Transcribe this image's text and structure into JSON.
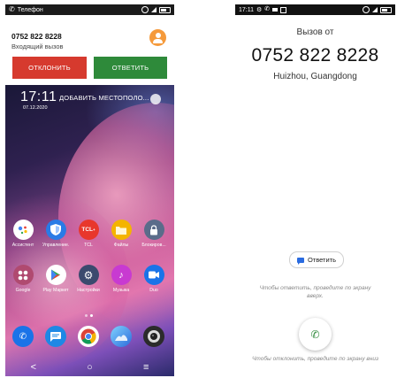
{
  "left_phone": {
    "statusbar": {
      "app_name": "Телефон"
    },
    "incoming_call": {
      "number": "0752 822 8228",
      "subtitle": "Входящий вызов",
      "decline_label": "ОТКЛОНИТЬ",
      "accept_label": "ОТВЕТИТЬ",
      "decline_color": "#d63a2e",
      "accept_color": "#2e8a3a",
      "avatar_color": "#f59a3b"
    },
    "home": {
      "clock": "17:11",
      "date": "07.12.2020",
      "add_location": "ДОБАВИТЬ МЕСТОПОЛО...",
      "apps_row1": [
        {
          "label": "Ассистент",
          "icon": "assistant-icon",
          "color": "#ffffff"
        },
        {
          "label": "Управление...",
          "icon": "shield-icon",
          "color": "#2a7be6"
        },
        {
          "label": "TCL",
          "icon": "tcl-icon",
          "color": "#e8372c"
        },
        {
          "label": "Файлы",
          "icon": "folder-icon",
          "color": "#f4b400"
        },
        {
          "label": "Блокиров...",
          "icon": "lock-icon",
          "color": "#5a6c8a"
        }
      ],
      "apps_row2": [
        {
          "label": "Google",
          "icon": "google-folder-icon",
          "color": "#b04a70"
        },
        {
          "label": "Play Маркет",
          "icon": "play-store-icon",
          "color": "#ffffff"
        },
        {
          "label": "Настройки",
          "icon": "settings-icon",
          "color": "#3b4a6e"
        },
        {
          "label": "Музыка",
          "icon": "music-icon",
          "color": "#c83ad1"
        },
        {
          "label": "Duo",
          "icon": "video-icon",
          "color": "#1a73e8"
        }
      ],
      "tcl_text": "TCL",
      "tcl_sup": "+",
      "dock": [
        {
          "icon": "phone-icon",
          "color": "#1a73e8"
        },
        {
          "icon": "messages-icon",
          "color": "#1e88e5"
        },
        {
          "icon": "chrome-icon",
          "color": "#ffffff"
        },
        {
          "icon": "gallery-icon",
          "color": "#2d9cdb"
        },
        {
          "icon": "camera-icon",
          "color": "#2b2b2b"
        }
      ],
      "nav": {
        "back": "<",
        "home": "○",
        "recents": "≡"
      }
    }
  },
  "right_phone": {
    "statusbar": {
      "time": "17:11"
    },
    "call_label": "Вызов от",
    "number": "0752 822 8228",
    "location": "Huizhou, Guangdong",
    "reply_label": "Ответить",
    "hint_answer": "Чтобы ответить, проведите по экрану вверх.",
    "hint_decline": "Чтобы отклонить, проведите по экрану вниз",
    "answer_color": "#2e8a3a"
  }
}
